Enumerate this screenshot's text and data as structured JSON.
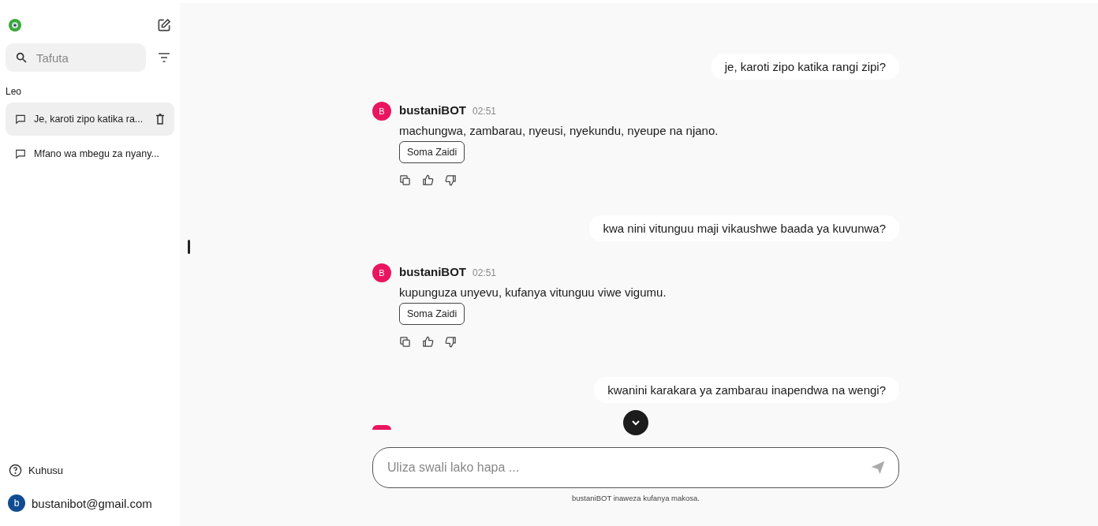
{
  "sidebar": {
    "search": {
      "placeholder": "Tafuta"
    },
    "section": "Leo",
    "conversations": [
      {
        "title": "Je, karoti zipo katika ra...",
        "selected": true
      },
      {
        "title": "Mfano wa mbegu za nyany...",
        "selected": false
      }
    ],
    "about": "Kuhusu",
    "account": {
      "avatar": "b",
      "email": "bustanibot@gmail.com"
    }
  },
  "messages": [
    {
      "kind": "user",
      "text": "je, karoti zipo katika rangi zipi?"
    },
    {
      "kind": "bot",
      "avatar": "B",
      "name": "bustaniBOT",
      "time": "02:51",
      "text": "machungwa, zambarau, nyeusi, nyekundu, nyeupe na njano.",
      "button": "Soma Zaidi"
    },
    {
      "kind": "user",
      "text": "kwa nini vitunguu maji vikaushwe baada ya kuvunwa?"
    },
    {
      "kind": "bot",
      "avatar": "B",
      "name": "bustaniBOT",
      "time": "02:51",
      "text": "kupunguza unyevu, kufanya vitunguu viwe vigumu.",
      "button": "Soma Zaidi"
    },
    {
      "kind": "user",
      "text": "kwanini karakara ya zambarau inapendwa na wengi?"
    }
  ],
  "composer": {
    "placeholder": "Uliza swali lako hapa ...",
    "disclaimer": "bustaniBOT inaweza kufanya makosa."
  }
}
